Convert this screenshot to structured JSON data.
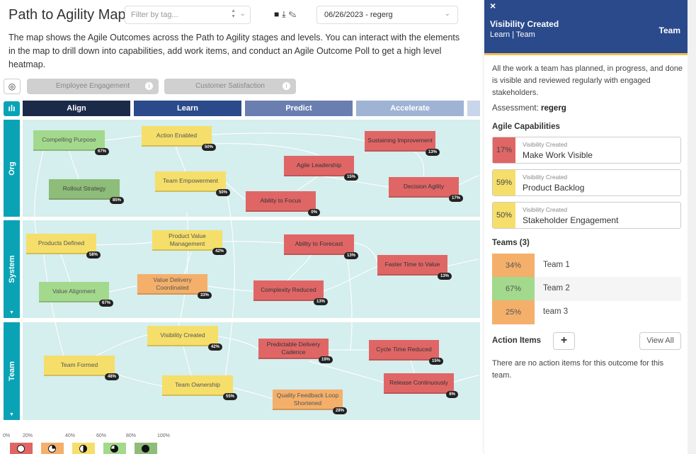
{
  "header": {
    "title": "Path to Agility Map",
    "filter_placeholder": "Filter by tag...",
    "date_value": "06/26/2023 - regerg",
    "description": "The map shows the Agile Outcomes across the Path to Agility stages and levels. You can interact with the elements in the map to drill down into capabilities, add work items, and conduct an Agile Outcome Poll to get a high level heatmap."
  },
  "metrics": [
    "Employee Engagement",
    "Customer Satisfaction"
  ],
  "stages": [
    {
      "label": "Align",
      "color": "#1c2a4a"
    },
    {
      "label": "Learn",
      "color": "#2a4a8c"
    },
    {
      "label": "Predict",
      "color": "#6a7fb0"
    },
    {
      "label": "Accelerate",
      "color": "#9fb3d4"
    }
  ],
  "levels": [
    "Org",
    "System",
    "Team"
  ],
  "nodes": [
    {
      "label": "Compelling Purpose",
      "pct": "67%",
      "color": "green"
    },
    {
      "label": "Rollout Strategy",
      "pct": "85%",
      "color": "dkgreen"
    },
    {
      "label": "Action Enabled",
      "pct": "50%",
      "color": "yellow"
    },
    {
      "label": "Team Empowerment",
      "pct": "50%",
      "color": "yellow"
    },
    {
      "label": "Agile Leadership",
      "pct": "15%",
      "color": "red"
    },
    {
      "label": "Ability to Focus",
      "pct": "0%",
      "color": "red"
    },
    {
      "label": "Sustaining Improvement",
      "pct": "13%",
      "color": "red"
    },
    {
      "label": "Decision Agility",
      "pct": "17%",
      "color": "red"
    },
    {
      "label": "Products Defined",
      "pct": "58%",
      "color": "yellow"
    },
    {
      "label": "Value Alignment",
      "pct": "67%",
      "color": "green"
    },
    {
      "label": "Product Value Management",
      "pct": "42%",
      "color": "yellow"
    },
    {
      "label": "Value Delivery Coordinated",
      "pct": "33%",
      "color": "orange"
    },
    {
      "label": "Ability to Forecast",
      "pct": "13%",
      "color": "red"
    },
    {
      "label": "Complexity Reduced",
      "pct": "13%",
      "color": "red"
    },
    {
      "label": "Faster Time to Value",
      "pct": "13%",
      "color": "red"
    },
    {
      "label": "Team Formed",
      "pct": "48%",
      "color": "yellow"
    },
    {
      "label": "Visibility Created",
      "pct": "42%",
      "color": "yellow"
    },
    {
      "label": "Team Ownership",
      "pct": "55%",
      "color": "yellow"
    },
    {
      "label": "Predictable Delivery Cadence",
      "pct": "19%",
      "color": "red"
    },
    {
      "label": "Quality Feedback Loop Shortened",
      "pct": "28%",
      "color": "orange"
    },
    {
      "label": "Cycle Time Reduced",
      "pct": "15%",
      "color": "red"
    },
    {
      "label": "Release Continuously",
      "pct": "6%",
      "color": "red"
    }
  ],
  "legend": {
    "ticks": [
      "0%",
      "20%",
      "40%",
      "60%",
      "80%",
      "100%"
    ],
    "colors": [
      "#e06666",
      "#f4b06a",
      "#f5df6a",
      "#a3d98c",
      "#8dbd78"
    ]
  },
  "panel": {
    "close": "×",
    "title": "Visibility Created",
    "subtitle": "Learn | Team",
    "level": "Team",
    "description": "All the work a team has planned, in progress, and done is visible and reviewed regularly with engaged stakeholders.",
    "assessment_label": "Assessment: ",
    "assessment_value": "regerg",
    "capabilities_heading": "Agile Capabilities",
    "capabilities": [
      {
        "pct": "17%",
        "sub": "Visibility Created",
        "name": "Make Work Visible",
        "color": "#e06666"
      },
      {
        "pct": "59%",
        "sub": "Visibility Created",
        "name": "Product Backlog",
        "color": "#f5df6a"
      },
      {
        "pct": "50%",
        "sub": "Visibility Created",
        "name": "Stakeholder Engagement",
        "color": "#f5df6a"
      }
    ],
    "teams_heading": "Teams (3)",
    "teams": [
      {
        "pct": "34%",
        "name": "Team 1",
        "color": "#f4b06a"
      },
      {
        "pct": "67%",
        "name": "Team 2",
        "color": "#a3d98c"
      },
      {
        "pct": "25%",
        "name": "team 3",
        "color": "#f4b06a"
      }
    ],
    "action_items_heading": "Action Items",
    "add_label": "+",
    "view_all_label": "View All",
    "empty_text": "There are no action items for this outcome for this team."
  }
}
